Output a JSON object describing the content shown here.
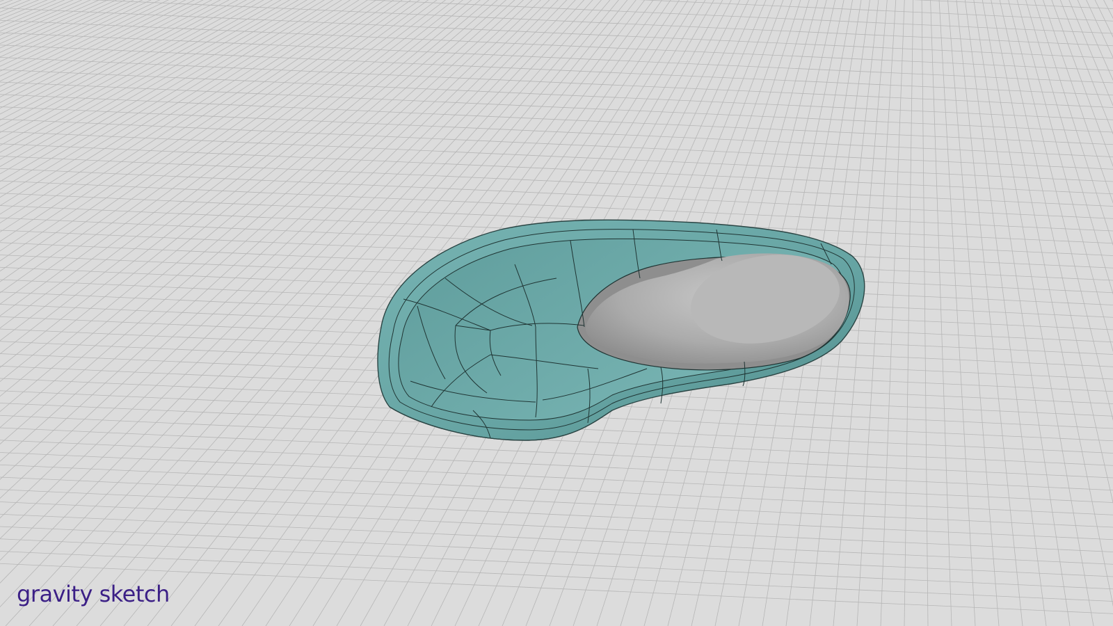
{
  "app": {
    "watermark": "gravity sketch"
  },
  "colors": {
    "background": "#dcdcdc",
    "grid_line": "#b4b4b4",
    "shell_fill": "#6aa9a8",
    "shell_dark": "#4f8c8b",
    "last_fill": "#b9b9b9",
    "wire": "#1f3433",
    "watermark": "#3b1f86"
  },
  "scene": {
    "object": "shoe-shell-model",
    "insert": "shoe-last-model"
  }
}
